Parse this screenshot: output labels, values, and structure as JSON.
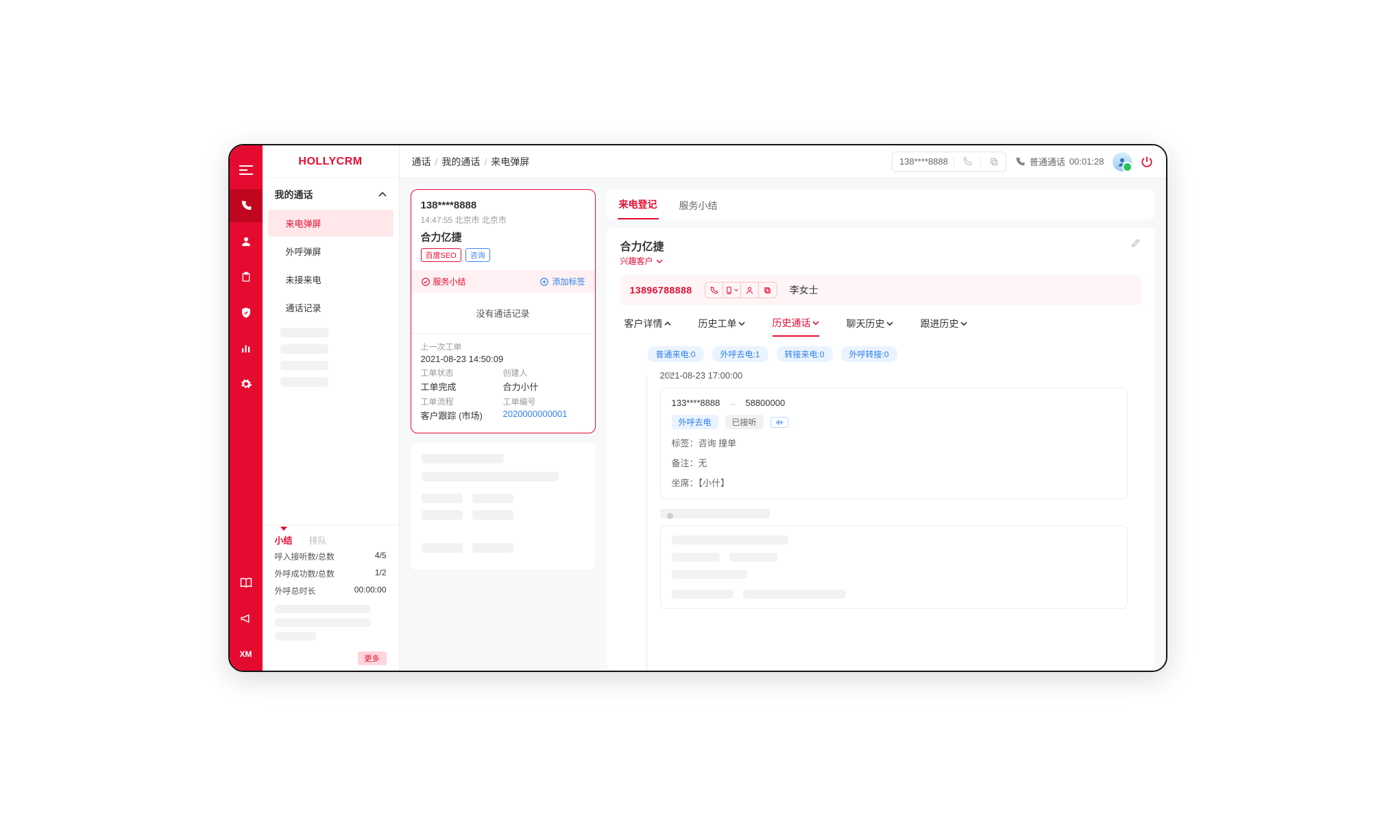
{
  "brand": "HOLLYCRM",
  "rail": {
    "xm": "XM"
  },
  "breadcrumb": {
    "a": "通话",
    "b": "我的通话",
    "c": "来电弹屏"
  },
  "topbar": {
    "phone": "138****8888",
    "call_state_label": "普通通话",
    "call_timer": "00:01:28"
  },
  "sidebar": {
    "section": "我的通话",
    "items": [
      "来电弹屏",
      "外呼弹屏",
      "未接来电",
      "通话记录"
    ],
    "stat_tabs": [
      "小结",
      "排队"
    ],
    "stats": [
      {
        "k": "呼入接听数/总数",
        "v": "4/5"
      },
      {
        "k": "外呼成功数/总数",
        "v": "1/2"
      },
      {
        "k": "外呼总时长",
        "v": "00:00:00"
      }
    ],
    "more": "更多"
  },
  "call_card": {
    "phone": "138****8888",
    "time_loc": "14:47:55 北京市  北京市",
    "name": "合力亿捷",
    "badge1": "百度SEO",
    "badge2": "咨询",
    "summary_btn": "服务小结",
    "add_tag_btn": "添加标签",
    "empty": "没有通话记录",
    "last_order_label": "上一次工单",
    "last_order_time": "2021-08-23 14:50:09",
    "rows": [
      {
        "l1": "工单状态",
        "l2": "创建人",
        "v1": "工单完成",
        "v2": "合力小什"
      },
      {
        "l1": "工单流程",
        "l2": "工单编号",
        "v1": "客户跟踪 (市场)",
        "v2": "2020000000001",
        "link": true
      }
    ]
  },
  "tabs_top": [
    "来电登记",
    "服务小结"
  ],
  "customer": {
    "name": "合力亿捷",
    "tag": "兴趣客户",
    "phone": "13896788888",
    "contact": "李女士"
  },
  "hist_tabs": [
    "客户详情",
    "历史工单",
    "历史通话",
    "聊天历史",
    "跟进历史"
  ],
  "hist_tab_active_index": 2,
  "chips": [
    "普通来电:0",
    "外呼去电:1",
    "转接来电:0",
    "外呼转接:0"
  ],
  "timeline": {
    "time": "2021-08-23  17:00:00",
    "from": "133****8888",
    "to": "58800000",
    "b1": "外呼去电",
    "b2": "已接听",
    "label_line": "标签：咨询   撞单",
    "note_line": "备注：无",
    "seat_line": "坐席：【小什】"
  }
}
